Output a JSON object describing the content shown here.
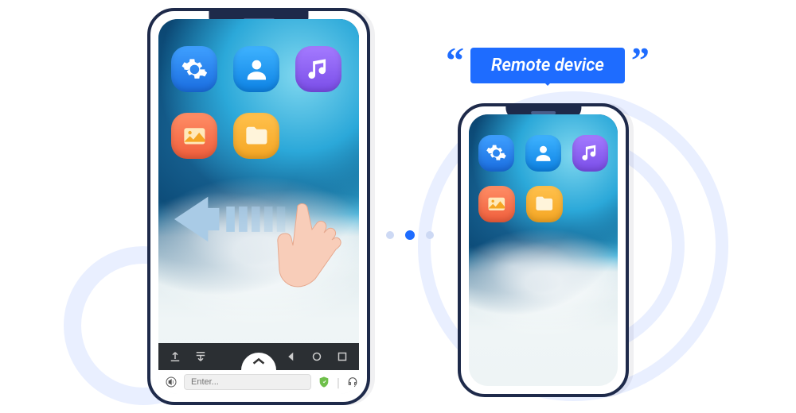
{
  "remote_label": "Remote device",
  "quote_left": "“",
  "quote_right": "”",
  "input": {
    "placeholder": "Enter..."
  },
  "icons": {
    "settings": "settings-icon",
    "contact": "contact-icon",
    "music": "music-icon",
    "gallery": "gallery-icon",
    "files": "files-icon"
  },
  "nav": {
    "upload": "upload-icon",
    "download": "download-icon",
    "back": "back-icon",
    "home": "home-icon",
    "recent": "recent-icon",
    "expand": "chevron-up-icon"
  },
  "toolbar": {
    "sound": "sound-icon",
    "shield": "shield-icon",
    "headset": "headset-icon",
    "more": "..."
  }
}
